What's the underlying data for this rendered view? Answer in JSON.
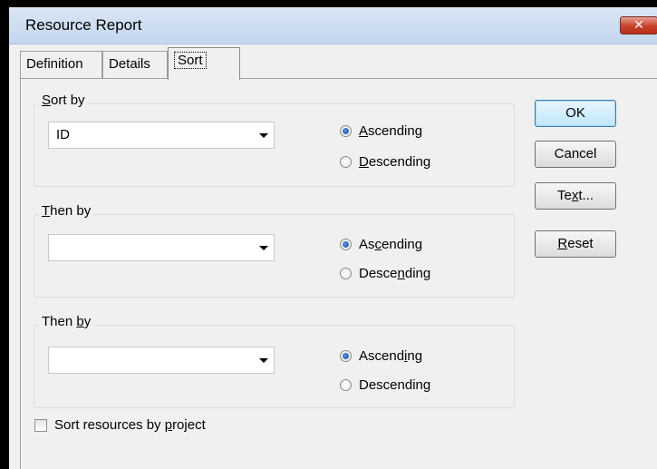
{
  "window": {
    "title": "Resource Report",
    "close_glyph": "✕"
  },
  "tabs": [
    {
      "label": "Definition",
      "active": false
    },
    {
      "label": "Details",
      "active": false
    },
    {
      "label": "Sort",
      "active": true
    }
  ],
  "groups": [
    {
      "label_pre": "",
      "label_key": "S",
      "label_post": "ort by",
      "value": "ID",
      "asc_pre": "",
      "asc_key": "A",
      "asc_post": "scending",
      "desc_pre": "",
      "desc_key": "D",
      "desc_post": "escending",
      "selected": "Ascending"
    },
    {
      "label_pre": "",
      "label_key": "T",
      "label_post": "hen by",
      "value": "",
      "asc_pre": "As",
      "asc_key": "c",
      "asc_post": "ending",
      "desc_pre": "Desce",
      "desc_key": "n",
      "desc_post": "ding",
      "selected": "Ascending"
    },
    {
      "label_pre": "Then ",
      "label_key": "b",
      "label_post": "y",
      "value": "",
      "asc_pre": "Ascend",
      "asc_key": "i",
      "asc_post": "ng",
      "desc_pre": "Descendin",
      "desc_key": "g",
      "desc_post": "",
      "selected": "Ascending"
    }
  ],
  "buttons": {
    "ok": {
      "pre": "",
      "key": "",
      "post": "OK"
    },
    "cancel": {
      "pre": "",
      "key": "",
      "post": "Cancel"
    },
    "text": {
      "pre": "Te",
      "key": "x",
      "post": "t..."
    },
    "reset": {
      "pre": "",
      "key": "R",
      "post": "eset"
    }
  },
  "sort_by_project": {
    "pre": "Sort resources by ",
    "key": "p",
    "post": "roject",
    "checked": false
  },
  "colors": {
    "accent": "#3c7fb1",
    "radio_selected": "#1c4fa0",
    "close_button": "#c7412c"
  }
}
